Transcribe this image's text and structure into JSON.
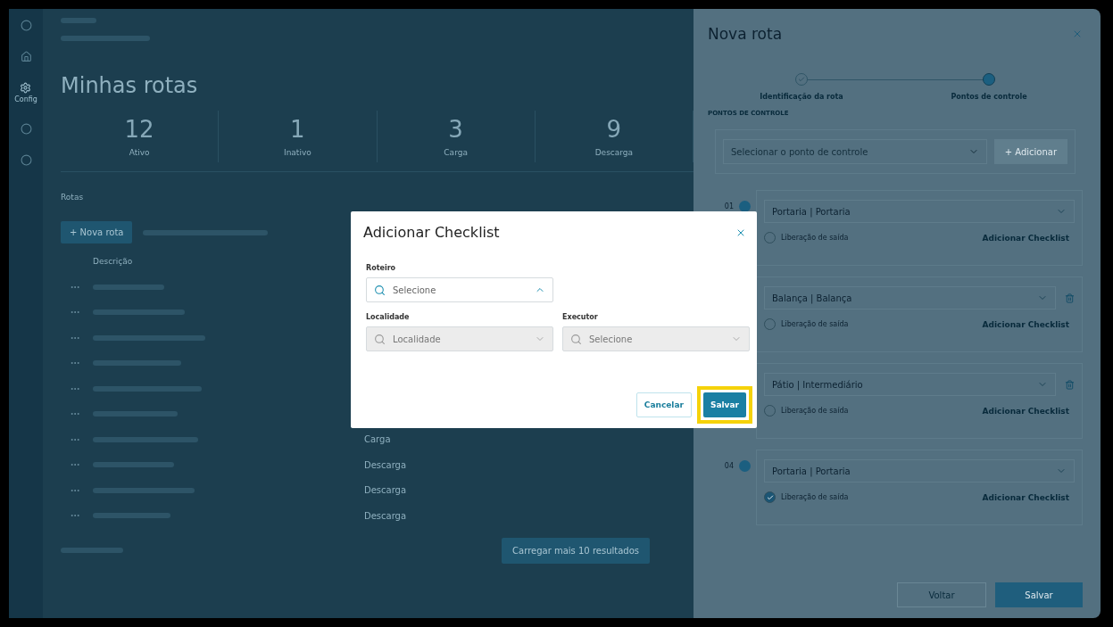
{
  "sidebar": {
    "items": [
      {
        "selected": false
      },
      {
        "selected": false
      },
      {
        "label": "Config",
        "selected": true
      },
      {
        "selected": false
      },
      {
        "selected": false
      }
    ]
  },
  "page": {
    "title": "Minhas rotas"
  },
  "stats": [
    {
      "value": "12",
      "label": "Ativo"
    },
    {
      "value": "1",
      "label": "Inativo"
    },
    {
      "value": "3",
      "label": "Carga"
    },
    {
      "value": "9",
      "label": "Descarga"
    }
  ],
  "routes": {
    "title": "Rotas",
    "new_button": "+ Nova rota",
    "columns": [
      "Descrição"
    ],
    "rows": [
      {
        "kind": "covered"
      },
      {
        "kind": "covered"
      },
      {
        "kind": "covered"
      },
      {
        "kind": "covered"
      },
      {
        "kind": "covered"
      },
      {
        "kind": "covered"
      },
      {
        "kind": "typed",
        "type": "Carga"
      },
      {
        "kind": "typed",
        "type": "Descarga"
      },
      {
        "kind": "typed",
        "type": "Descarga"
      },
      {
        "kind": "typed",
        "type": "Descarga"
      }
    ],
    "load_more": "Carregar mais 10 resultados"
  },
  "panel": {
    "title": "Nova rota",
    "steps": [
      {
        "label": "Identificação da rota",
        "done": true,
        "selected": false
      },
      {
        "label": "Pontos de controle",
        "done": false,
        "selected": true
      }
    ],
    "section": "PONTOS DE CONTROLE",
    "select_placeholder": "Selecionar o ponto de controle",
    "add_button": "+ Adicionar",
    "checkpoints": [
      {
        "number": "01",
        "value": "Portaria | Portaria",
        "deletable": false,
        "release": {
          "label": "Liberação de saída",
          "checked": false
        },
        "checklist": "Adicionar Checklist"
      },
      {
        "value": "Balança | Balança",
        "deletable": true,
        "release": {
          "label": "Liberação de saída",
          "checked": false
        },
        "checklist": "Adicionar Checklist"
      },
      {
        "value": "Pátio | Intermediário",
        "deletable": true,
        "release": {
          "label": "Liberação de saída",
          "checked": false
        },
        "checklist": "Adicionar Checklist"
      },
      {
        "number": "04",
        "value": "Portaria | Portaria",
        "deletable": false,
        "release": {
          "label": "Liberação de saída",
          "checked": true
        },
        "checklist": "Adicionar Checklist"
      }
    ],
    "back": "Voltar",
    "save": "Salvar"
  },
  "modal": {
    "title": "Adicionar Checklist",
    "fields": [
      {
        "label": "Roteiro",
        "placeholder": "Selecione",
        "open": true,
        "disabled": false
      },
      {
        "label": "Localidade",
        "placeholder": "Localidade",
        "open": false,
        "disabled": true
      },
      {
        "label": "Executor",
        "placeholder": "Selecione",
        "open": false,
        "disabled": true
      }
    ],
    "cancel": "Cancelar",
    "save": {
      "label": "Salvar",
      "highlighted": true
    }
  }
}
